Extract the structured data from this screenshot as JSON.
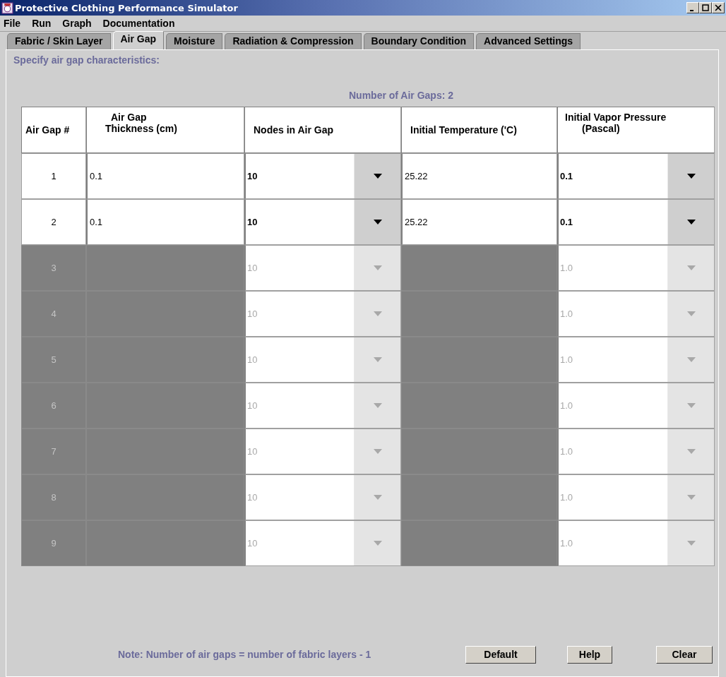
{
  "window": {
    "title": "Protective Clothing Performance Simulator"
  },
  "menu": [
    "File",
    "Run",
    "Graph",
    "Documentation"
  ],
  "tabs": [
    {
      "label": "Fabric / Skin Layer",
      "selected": false
    },
    {
      "label": "Air Gap",
      "selected": true
    },
    {
      "label": "Moisture",
      "selected": false
    },
    {
      "label": "Radiation & Compression",
      "selected": false
    },
    {
      "label": "Boundary Condition",
      "selected": false
    },
    {
      "label": "Advanced Settings",
      "selected": false
    }
  ],
  "instruction": "Specify air gap characteristics:",
  "count_label": "Number of Air Gaps: 2",
  "table": {
    "columns": [
      [
        "Air Gap #"
      ],
      [
        "Air Gap",
        "Thickness (cm)"
      ],
      [
        "Nodes in Air Gap"
      ],
      [
        "Initial Temperature ('C)"
      ],
      [
        "Initial Vapor Pressure",
        "(Pascal)"
      ]
    ],
    "rows": [
      {
        "number": "1",
        "thickness": "0.1",
        "nodes": "10",
        "temperature": "25.22",
        "vapor": "0.1",
        "disabled": false
      },
      {
        "number": "2",
        "thickness": "0.1",
        "nodes": "10",
        "temperature": "25.22",
        "vapor": "0.1",
        "disabled": false
      },
      {
        "number": "3",
        "nodes": "10",
        "vapor": "1.0",
        "disabled": true
      },
      {
        "number": "4",
        "nodes": "10",
        "vapor": "1.0",
        "disabled": true
      },
      {
        "number": "5",
        "nodes": "10",
        "vapor": "1.0",
        "disabled": true
      },
      {
        "number": "6",
        "nodes": "10",
        "vapor": "1.0",
        "disabled": true
      },
      {
        "number": "7",
        "nodes": "10",
        "vapor": "1.0",
        "disabled": true
      },
      {
        "number": "8",
        "nodes": "10",
        "vapor": "1.0",
        "disabled": true
      },
      {
        "number": "9",
        "nodes": "10",
        "vapor": "1.0",
        "disabled": true
      }
    ]
  },
  "note": "Note: Number of air gaps = number of fabric layers - 1",
  "buttons": [
    "Default",
    "Help",
    "Clear"
  ]
}
